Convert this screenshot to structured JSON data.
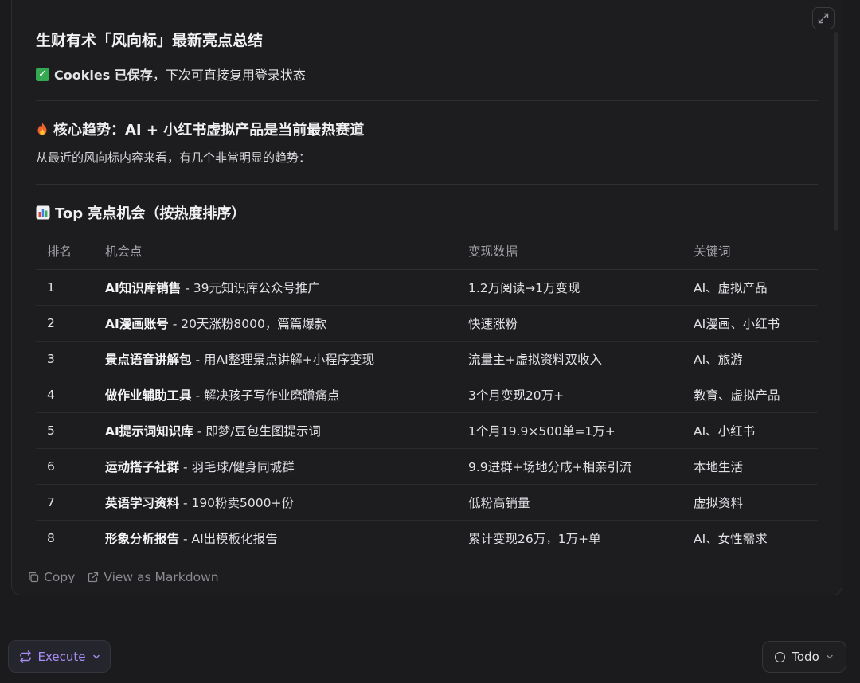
{
  "card": {
    "title": "生财有术「风向标」最新亮点总结",
    "saved_bold": "Cookies 已保存",
    "saved_rest": "，下次可直接复用登录状态",
    "trend_heading": "核心趋势：AI + 小红书虚拟产品是当前最热赛道",
    "trend_text": "从最近的风向标内容来看，有几个非常明显的趋势：",
    "top_heading": "Top 亮点机会（按热度排序）"
  },
  "table": {
    "headers": [
      "排名",
      "机会点",
      "变现数据",
      "关键词"
    ],
    "rows": [
      {
        "rank": "1",
        "title": "AI知识库销售",
        "desc": " - 39元知识库公众号推广",
        "data": "1.2万阅读→1万变现",
        "kw": "AI、虚拟产品"
      },
      {
        "rank": "2",
        "title": "AI漫画账号",
        "desc": " - 20天涨粉8000，篇篇爆款",
        "data": "快速涨粉",
        "kw": "AI漫画、小红书"
      },
      {
        "rank": "3",
        "title": "景点语音讲解包",
        "desc": " - 用AI整理景点讲解+小程序变现",
        "data": "流量主+虚拟资料双收入",
        "kw": "AI、旅游"
      },
      {
        "rank": "4",
        "title": "做作业辅助工具",
        "desc": " - 解决孩子写作业磨蹭痛点",
        "data": "3个月变现20万+",
        "kw": "教育、虚拟产品"
      },
      {
        "rank": "5",
        "title": "AI提示词知识库",
        "desc": " - 即梦/豆包生图提示词",
        "data": "1个月19.9×500单=1万+",
        "kw": "AI、小红书"
      },
      {
        "rank": "6",
        "title": "运动搭子社群",
        "desc": " - 羽毛球/健身同城群",
        "data": "9.9进群+场地分成+相亲引流",
        "kw": "本地生活"
      },
      {
        "rank": "7",
        "title": "英语学习资料",
        "desc": " - 190粉卖5000+份",
        "data": "低粉高销量",
        "kw": "虚拟资料"
      },
      {
        "rank": "8",
        "title": "形象分析报告",
        "desc": " - AI出模板化报告",
        "data": "累计变现26万，1万+单",
        "kw": "AI、女性需求"
      }
    ]
  },
  "footer": {
    "copy": "Copy",
    "markdown": "View as Markdown"
  },
  "bottom": {
    "execute": "Execute",
    "todo": "Todo"
  },
  "colors": {
    "accent": "#a98ef5",
    "check": "#35a852",
    "background": "#1b1b1d"
  },
  "icons": {
    "expand": "expand-icon",
    "copy": "copy-icon",
    "external": "external-link-icon",
    "execute": "repeat-icon",
    "fire": "fire-icon",
    "chart": "bar-chart-icon"
  }
}
